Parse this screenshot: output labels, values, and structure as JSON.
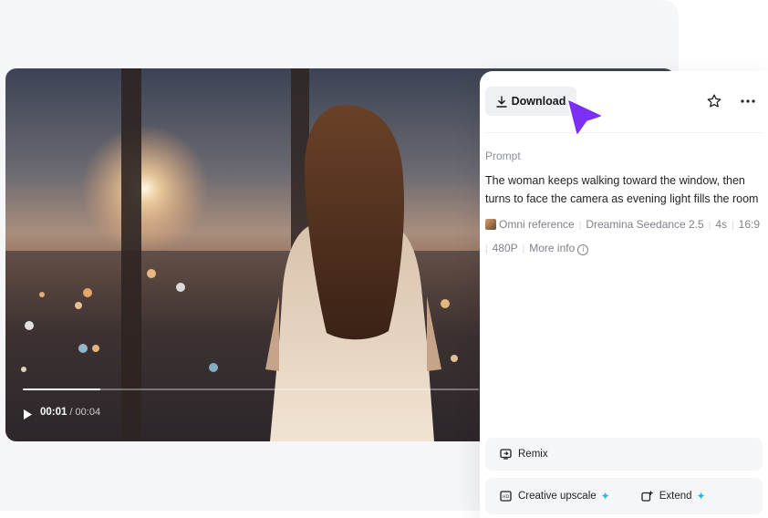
{
  "player": {
    "current_time": "00:01",
    "total_time": "/ 00:04",
    "progress": 0.17
  },
  "panel": {
    "download_label": "Download",
    "prompt_label": "Prompt",
    "prompt_text": "The woman keeps walking toward the window, then turns to face the camera as evening light fills the room",
    "meta": {
      "reference": "Omni reference",
      "model": "Dreamina Seedance 2.5",
      "duration": "4s",
      "ratio": "16:9",
      "resolution": "480P",
      "more_info": "More info"
    },
    "actions": {
      "remix": "Remix",
      "creative_upscale": "Creative upscale",
      "extend": "Extend"
    }
  },
  "colors": {
    "accent": "#7b2ff7",
    "sparkle": "#22b8e6",
    "panel_bg": "#ffffff",
    "page_bg": "#f5f6f8"
  },
  "icons": [
    "download-icon",
    "star-icon",
    "more-icon",
    "play-icon",
    "info-icon",
    "remix-icon",
    "upscale-icon",
    "extend-icon",
    "cursor-icon"
  ]
}
